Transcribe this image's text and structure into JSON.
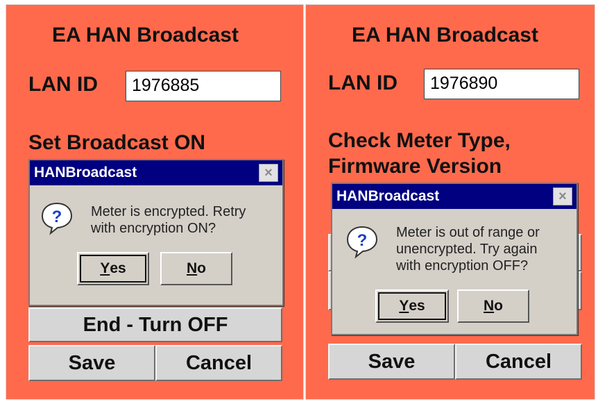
{
  "left": {
    "title": "EA HAN Broadcast",
    "lan_label": "LAN ID",
    "lan_value": "1976885",
    "status_lines": [
      "Set Broadcast ON"
    ],
    "end_button": "End - Turn OFF",
    "save_button": "Save",
    "cancel_button": "Cancel",
    "dialog": {
      "title": "HANBroadcast",
      "close_glyph": "×",
      "message_lines": [
        "Meter is encrypted. Retry",
        "with encryption ON?"
      ],
      "yes_mnemonic": "Y",
      "yes_rest": "es",
      "no_mnemonic": "N",
      "no_rest": "o",
      "icon": "question-icon"
    }
  },
  "right": {
    "title": "EA HAN Broadcast",
    "lan_label": "LAN ID",
    "lan_value": "1976890",
    "status_lines": [
      "Check Meter Type,",
      "Firmware Version"
    ],
    "save_button": "Save",
    "cancel_button": "Cancel",
    "dialog": {
      "title": "HANBroadcast",
      "close_glyph": "×",
      "message_lines": [
        "Meter is out of range or",
        "unencrypted. Try again",
        "with encryption OFF?"
      ],
      "yes_mnemonic": "Y",
      "yes_rest": "es",
      "no_mnemonic": "N",
      "no_rest": "o",
      "icon": "question-icon"
    }
  },
  "colors": {
    "panel_bg": "#ff6a4d",
    "title_bar": "#000080",
    "dialog_bg": "#d4d0c8",
    "button_bg": "#d6d6d6"
  }
}
